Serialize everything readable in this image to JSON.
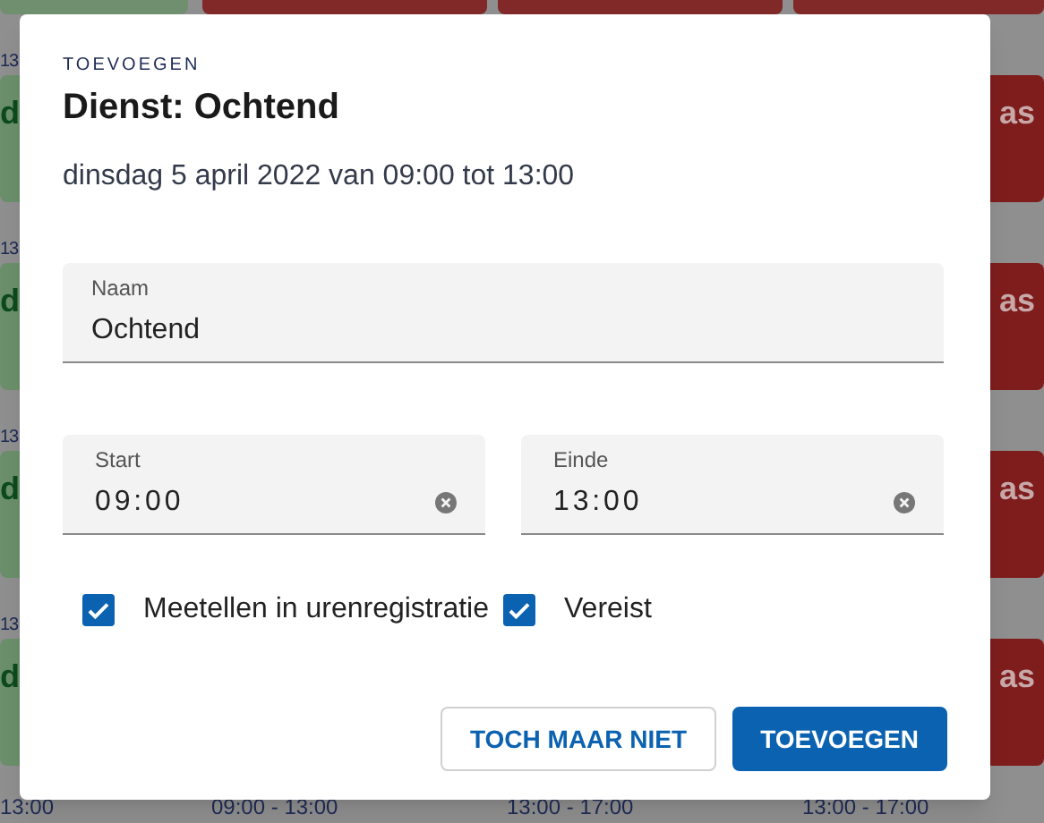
{
  "schedule": {
    "columns": [
      {
        "color": "#6b8f6b",
        "times": [
          "13",
          "13",
          "13",
          "13"
        ],
        "labels": [
          "d",
          "d",
          "d",
          "d"
        ],
        "footer_time": "13:00"
      },
      {
        "color": "#7f1d1d",
        "footer_time": "09:00 - 13:00"
      },
      {
        "color": "#7f1d1d",
        "footer_time": "13:00 - 17:00"
      },
      {
        "color": "#7f1d1d",
        "labels": [
          "as",
          "as",
          "as",
          "as"
        ],
        "footer_time": "13:00 - 17:00"
      }
    ]
  },
  "dialog": {
    "overline": "TOEVOEGEN",
    "title": "Dienst: Ochtend",
    "subtitle": "dinsdag 5 april 2022 van 09:00 tot 13:00",
    "name_field": {
      "label": "Naam",
      "value": "Ochtend"
    },
    "time_fields": [
      {
        "label": "Start",
        "value": "09:00"
      },
      {
        "label": "Einde",
        "value": "13:00"
      }
    ],
    "checkboxes": [
      {
        "label": "Meetellen in urenregistratie",
        "checked": true
      },
      {
        "label": "Vereist",
        "checked": true
      }
    ],
    "buttons": [
      {
        "label": "TOCH MAAR NIET",
        "kind": "outlined"
      },
      {
        "label": "TOEVOEGEN",
        "kind": "filled"
      }
    ]
  }
}
